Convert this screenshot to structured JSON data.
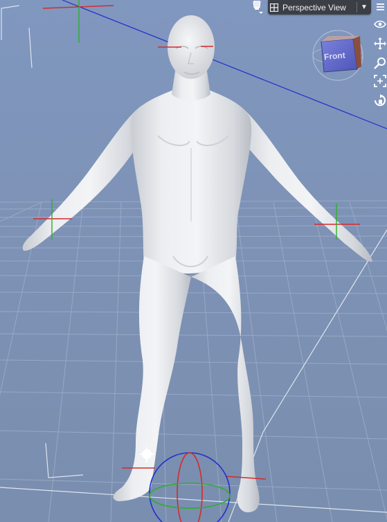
{
  "viewport": {
    "view_label": "Perspective View",
    "dropdown_glyph": "▼",
    "cube_face_label": "Front",
    "background_color": "#7f93b6",
    "figure_color": "#e6e8eb",
    "axis_colors": {
      "x": "#d42a2a",
      "y": "#2eae2e",
      "z": "#2a3fd6"
    }
  },
  "toolbar": {
    "left_icon": "light-bulb-icon",
    "right_tools": [
      "eye-icon",
      "menu-icon",
      "orbit-icon",
      "pan-icon",
      "zoom-icon",
      "frame-icon",
      "reset-view-icon"
    ]
  }
}
